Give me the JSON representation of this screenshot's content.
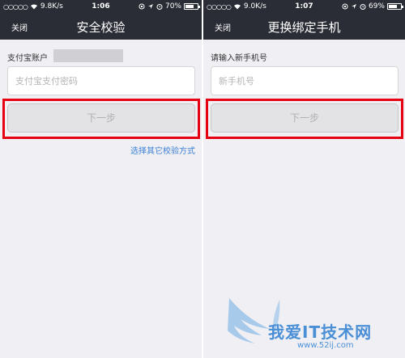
{
  "left_screen": {
    "status": {
      "carrier_dots": "○○○○○",
      "speed": "9.8K/s",
      "time": "1:06",
      "battery": "70%",
      "battery_level": 0.7
    },
    "nav": {
      "back_label": "关闭",
      "title": "安全校验"
    },
    "account_label": "支付宝账户",
    "password_placeholder": "支付宝支付密码",
    "next_button": "下一步",
    "alt_link": "选择其它校验方式"
  },
  "right_screen": {
    "status": {
      "carrier_dots": "○○○○○",
      "speed": "9.0K/s",
      "time": "1:07",
      "battery": "69%",
      "battery_level": 0.69
    },
    "nav": {
      "back_label": "关闭",
      "title": "更换绑定手机"
    },
    "phone_label": "请输入新手机号",
    "phone_placeholder": "新手机号",
    "next_button": "下一步"
  },
  "watermark": {
    "text": "我爱IT技术网",
    "url": "www.52ij.com"
  },
  "colors": {
    "navbar": "#2b2d36",
    "background": "#efeff4",
    "highlight": "#e60012",
    "link": "#3a7fd5"
  }
}
